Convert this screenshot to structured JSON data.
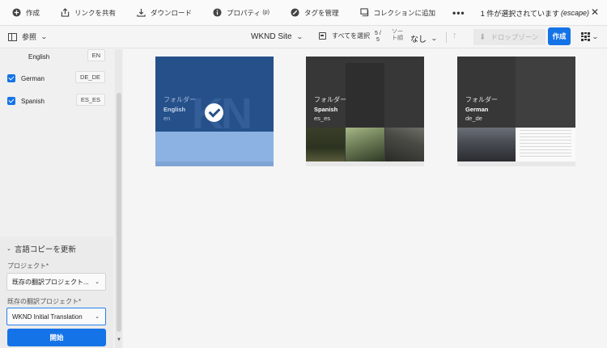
{
  "actionbar": {
    "items": [
      {
        "id": "create",
        "label": "作成",
        "icon": "plus-circle-icon"
      },
      {
        "id": "share",
        "label": "リンクを共有",
        "icon": "share-icon"
      },
      {
        "id": "download",
        "label": "ダウンロード",
        "icon": "download-icon"
      },
      {
        "id": "properties",
        "label": "プロパティ",
        "shortcut": "(p)",
        "icon": "info-icon"
      },
      {
        "id": "tags",
        "label": "タグを管理",
        "icon": "tag-icon"
      },
      {
        "id": "collection",
        "label": "コレクションに追加",
        "icon": "collection-add-icon"
      }
    ],
    "more": "•••",
    "selection_text": "1 件が選択されています",
    "selection_escape": "(escape)",
    "close": "✕"
  },
  "toolbar": {
    "rail_label": "参照",
    "site_title": "WKND Site",
    "select_all": "すべてを選択",
    "count_top": "5 /",
    "count_bottom": "5",
    "sort_label": "ソート順",
    "sort_value": "なし",
    "sort_dir": "↑",
    "dropzone": "ドロップゾーン",
    "create": "作成"
  },
  "languages": [
    {
      "name": "English",
      "code": "EN",
      "checked": false
    },
    {
      "name": "German",
      "code": "DE_DE",
      "checked": true
    },
    {
      "name": "Spanish",
      "code": "ES_ES",
      "checked": true
    }
  ],
  "update_panel": {
    "header": "言語コピーを更新",
    "project_label": "プロジェクト*",
    "project_value": "既存の翻訳プロジェクト...",
    "existing_label": "既存の翻訳プロジェクト*",
    "existing_value": "WKND Initial Translation",
    "start": "開始"
  },
  "cards": [
    {
      "kind": "フォルダー",
      "name": "English",
      "code": "en",
      "selected": true
    },
    {
      "kind": "フォルダー",
      "name": "Spanish",
      "code": "es_es",
      "selected": false
    },
    {
      "kind": "フォルダー",
      "name": "German",
      "code": "de_de",
      "selected": false
    }
  ],
  "colors": {
    "accent": "#1473e6",
    "selected_card": "#26508a"
  }
}
